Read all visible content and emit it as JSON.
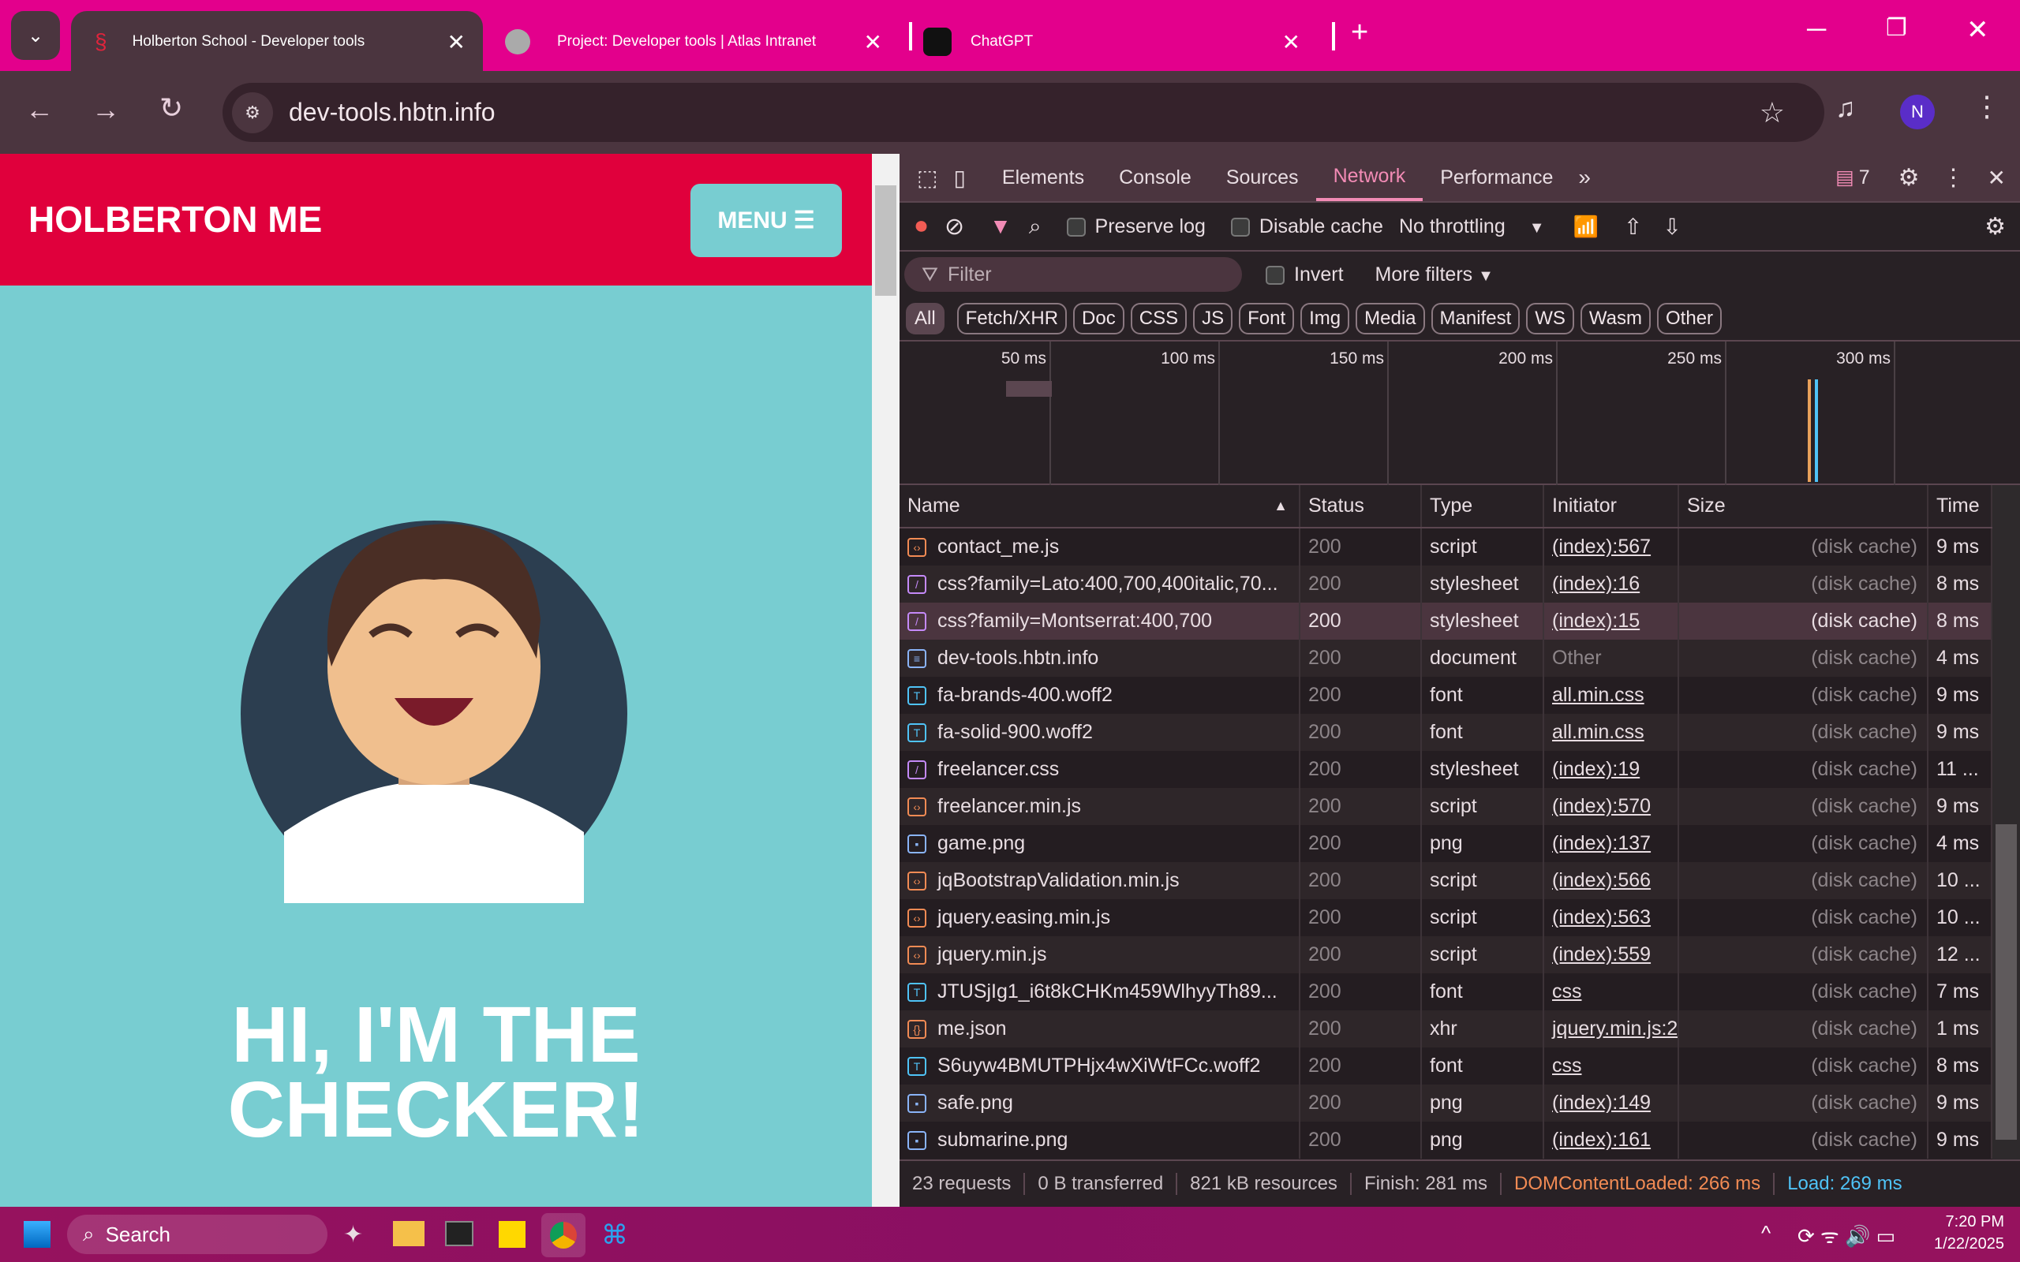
{
  "browser": {
    "tabs": [
      {
        "title": "Holberton School - Developer tools",
        "active": true
      },
      {
        "title": "Project: Developer tools | Atlas Intranet"
      },
      {
        "title": "ChatGPT"
      }
    ],
    "url": "dev-tools.hbtn.info",
    "profile_initial": "N"
  },
  "page": {
    "brand": "HOLBERTON ME",
    "menu_label": "MENU",
    "hero_line1": "HI, I'M THE",
    "hero_line2": "CHECKER!"
  },
  "devtools": {
    "panels": [
      "Elements",
      "Console",
      "Sources",
      "Network",
      "Performance"
    ],
    "active_panel": "Network",
    "issues_count": "7",
    "toolbar": {
      "preserve_log": "Preserve log",
      "disable_cache": "Disable cache",
      "throttling": "No throttling"
    },
    "filter_placeholder": "Filter",
    "invert": "Invert",
    "more_filters": "More filters",
    "type_filters": [
      "All",
      "Fetch/XHR",
      "Doc",
      "CSS",
      "JS",
      "Font",
      "Img",
      "Media",
      "Manifest",
      "WS",
      "Wasm",
      "Other"
    ],
    "timeline_ticks": [
      "50 ms",
      "100 ms",
      "150 ms",
      "200 ms",
      "250 ms",
      "300 ms"
    ],
    "columns": [
      "Name",
      "Status",
      "Type",
      "Initiator",
      "Size",
      "Time"
    ],
    "rows": [
      {
        "name": "contact_me.js",
        "status": "200",
        "type": "script",
        "initiator": "(index):567",
        "size": "(disk cache)",
        "time": "9 ms",
        "icon": "script"
      },
      {
        "name": "css?family=Lato:400,700,400italic,70...",
        "status": "200",
        "type": "stylesheet",
        "initiator": "(index):16",
        "size": "(disk cache)",
        "time": "8 ms",
        "icon": "css"
      },
      {
        "name": "css?family=Montserrat:400,700",
        "status": "200",
        "type": "stylesheet",
        "initiator": "(index):15",
        "size": "(disk cache)",
        "time": "8 ms",
        "icon": "css",
        "selected": true
      },
      {
        "name": "dev-tools.hbtn.info",
        "status": "200",
        "type": "document",
        "initiator": "Other",
        "size": "(disk cache)",
        "time": "4 ms",
        "icon": "doc"
      },
      {
        "name": "fa-brands-400.woff2",
        "status": "200",
        "type": "font",
        "initiator": "all.min.css",
        "size": "(disk cache)",
        "time": "9 ms",
        "icon": "font"
      },
      {
        "name": "fa-solid-900.woff2",
        "status": "200",
        "type": "font",
        "initiator": "all.min.css",
        "size": "(disk cache)",
        "time": "9 ms",
        "icon": "font"
      },
      {
        "name": "freelancer.css",
        "status": "200",
        "type": "stylesheet",
        "initiator": "(index):19",
        "size": "(disk cache)",
        "time": "11 ...",
        "icon": "css"
      },
      {
        "name": "freelancer.min.js",
        "status": "200",
        "type": "script",
        "initiator": "(index):570",
        "size": "(disk cache)",
        "time": "9 ms",
        "icon": "script"
      },
      {
        "name": "game.png",
        "status": "200",
        "type": "png",
        "initiator": "(index):137",
        "size": "(disk cache)",
        "time": "4 ms",
        "icon": "img"
      },
      {
        "name": "jqBootstrapValidation.min.js",
        "status": "200",
        "type": "script",
        "initiator": "(index):566",
        "size": "(disk cache)",
        "time": "10 ...",
        "icon": "script"
      },
      {
        "name": "jquery.easing.min.js",
        "status": "200",
        "type": "script",
        "initiator": "(index):563",
        "size": "(disk cache)",
        "time": "10 ...",
        "icon": "script"
      },
      {
        "name": "jquery.min.js",
        "status": "200",
        "type": "script",
        "initiator": "(index):559",
        "size": "(disk cache)",
        "time": "12 ...",
        "icon": "script"
      },
      {
        "name": "JTUSjIg1_i6t8kCHKm459WlhyyTh89...",
        "status": "200",
        "type": "font",
        "initiator": "css",
        "size": "(disk cache)",
        "time": "7 ms",
        "icon": "font"
      },
      {
        "name": "me.json",
        "status": "200",
        "type": "xhr",
        "initiator": "jquery.min.js:2",
        "size": "(disk cache)",
        "time": "1 ms",
        "icon": "xhr"
      },
      {
        "name": "S6uyw4BMUTPHjx4wXiWtFCc.woff2",
        "status": "200",
        "type": "font",
        "initiator": "css",
        "size": "(disk cache)",
        "time": "8 ms",
        "icon": "font"
      },
      {
        "name": "safe.png",
        "status": "200",
        "type": "png",
        "initiator": "(index):149",
        "size": "(disk cache)",
        "time": "9 ms",
        "icon": "img"
      },
      {
        "name": "submarine.png",
        "status": "200",
        "type": "png",
        "initiator": "(index):161",
        "size": "(disk cache)",
        "time": "9 ms",
        "icon": "img"
      }
    ],
    "status_bar": {
      "requests": "23 requests",
      "transferred": "0 B transferred",
      "resources": "821 kB resources",
      "finish": "Finish: 281 ms",
      "dcl": "DOMContentLoaded: 266 ms",
      "load": "Load: 269 ms"
    }
  },
  "taskbar": {
    "search": "Search",
    "time": "7:20 PM",
    "date": "1/22/2025"
  },
  "colors": {
    "accent": "#e3008c",
    "header_red": "#e0003c",
    "teal": "#78cdd1",
    "dcl": "#f28b54",
    "load": "#4fc3f7"
  }
}
